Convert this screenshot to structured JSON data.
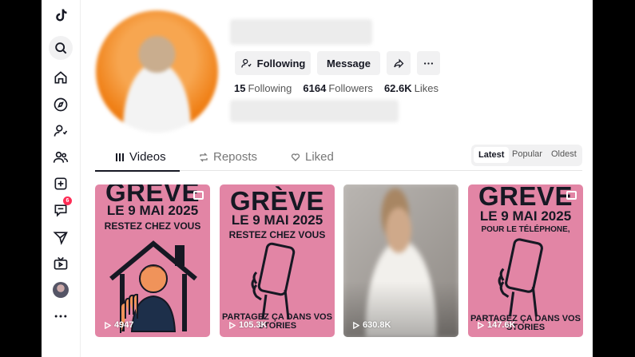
{
  "actions": {
    "following": "Following",
    "message": "Message"
  },
  "stats": [
    {
      "num": "15",
      "label": "Following"
    },
    {
      "num": "6164",
      "label": "Followers"
    },
    {
      "num": "62.6K",
      "label": "Likes"
    }
  ],
  "tabs": [
    "Videos",
    "Reposts",
    "Liked"
  ],
  "sort": [
    "Latest",
    "Popular",
    "Oldest"
  ],
  "nav_badge": "6",
  "videos": [
    {
      "greve": "GRÈVE",
      "date": "LE 9 MAI 2025",
      "line": "RESTEZ CHEZ VOUS",
      "foot": "",
      "views": "4947"
    },
    {
      "greve": "GRÈVE",
      "date": "LE 9 MAI 2025",
      "line": "RESTEZ CHEZ VOUS",
      "foot": "PARTAGEZ ÇA DANS VOS STORIES",
      "views": "105.3K"
    },
    {
      "greve": "",
      "date": "",
      "line": "",
      "foot": "",
      "views": "630.8K"
    },
    {
      "greve": "GREVE",
      "date": "LE 9 MAI 2025",
      "line": "POUR LE TÉLÉPHONE,",
      "foot": "PARTAGEZ ÇA DANS VOS STORIES",
      "views": "147.6K"
    }
  ]
}
